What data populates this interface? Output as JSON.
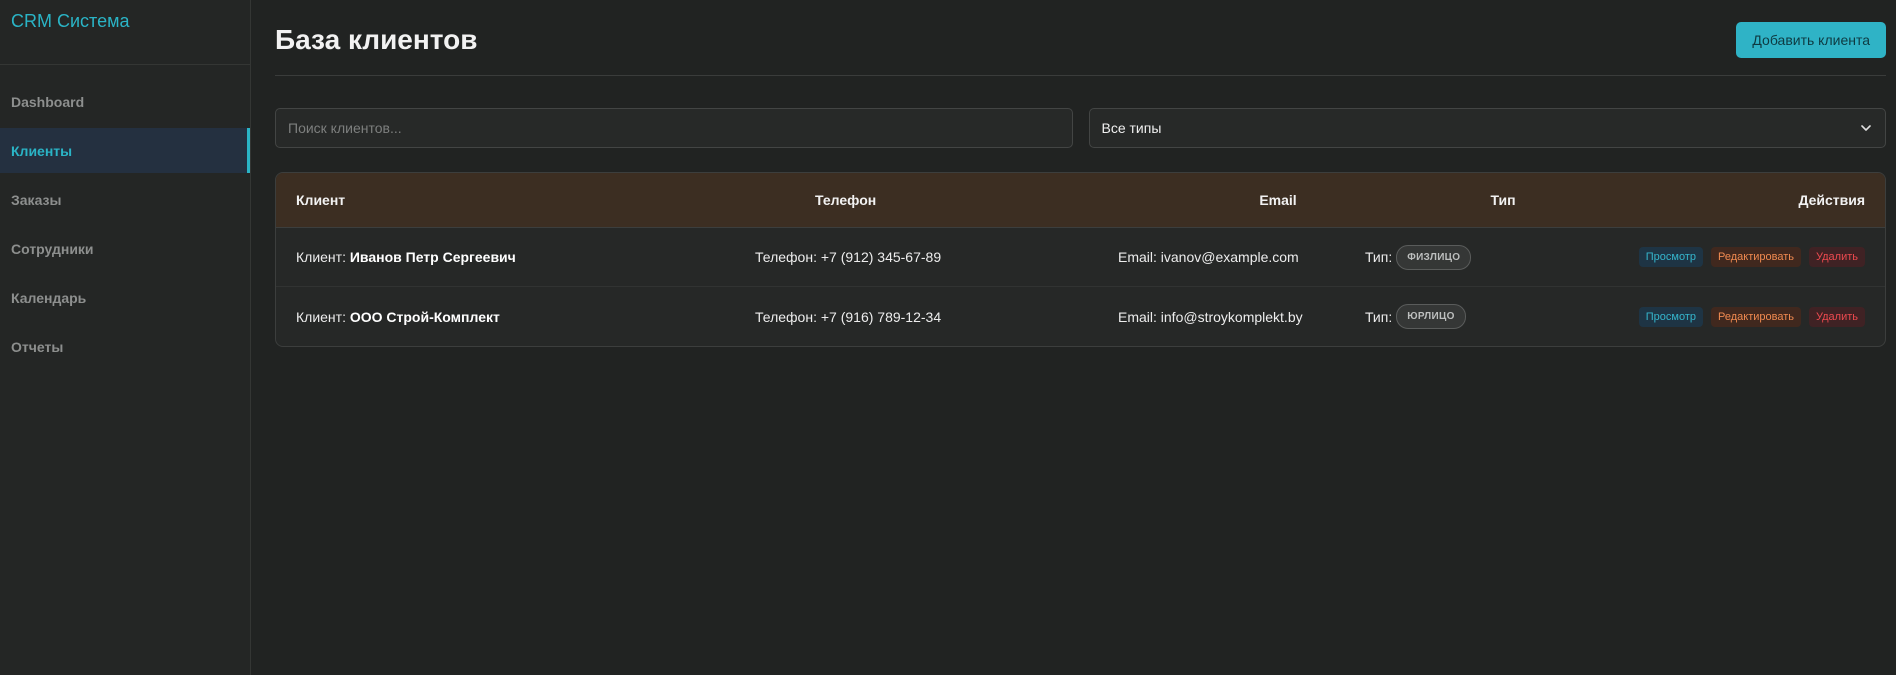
{
  "sidebar": {
    "brand": "CRM Система",
    "items": [
      {
        "label": "Dashboard"
      },
      {
        "label": "Клиенты"
      },
      {
        "label": "Заказы"
      },
      {
        "label": "Сотрудники"
      },
      {
        "label": "Календарь"
      },
      {
        "label": "Отчеты"
      }
    ],
    "active_index": 1
  },
  "header": {
    "title": "База клиентов",
    "add_button": "Добавить клиента"
  },
  "filters": {
    "search_placeholder": "Поиск клиентов...",
    "type_select": "Все типы"
  },
  "table": {
    "columns": [
      "Клиент",
      "Телефон",
      "Email",
      "Тип",
      "Действия"
    ],
    "rows": [
      {
        "client_prefix": "Клиент: ",
        "client": "Иванов Петр Сергеевич",
        "phone": "Телефон: +7 (912) 345-67-89",
        "email": "Email: ivanov@example.com",
        "type_prefix": "Тип:",
        "type": "ФИЗЛИЦО",
        "view": "Просмотр",
        "edit": "Редактировать",
        "delete": "Удалить"
      },
      {
        "client_prefix": "Клиент: ",
        "client": "ООО Строй-Комплект",
        "phone": "Телефон: +7 (916) 789-12-34",
        "email": "Email: info@stroykomplekt.by",
        "type_prefix": "Тип:",
        "type": "ЮРЛИЦО",
        "view": "Просмотр",
        "edit": "Редактировать",
        "delete": "Удалить"
      }
    ]
  },
  "colors": {
    "accent": "#2fb3c6",
    "header_bg": "#3c2e22",
    "background": "#212322"
  },
  "icons": {
    "select_chevron": "chevron-down-icon"
  }
}
